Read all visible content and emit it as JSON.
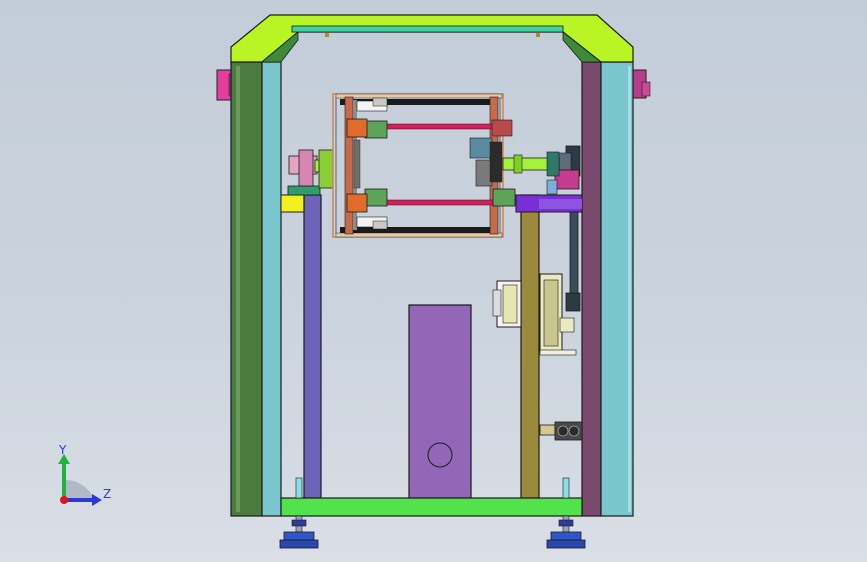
{
  "viewport": {
    "view_name": "Front view",
    "background_top": "#c3cdd9",
    "background_bottom": "#dadfe6"
  },
  "triad": {
    "y_label": "Y",
    "z_label": "Z",
    "x_axis_color": "#e0141e",
    "y_axis_color": "#1fb53a",
    "z_axis_color": "#2a3bd1"
  },
  "colors": {
    "top_frame": "#b9f524",
    "left_post": "#4b7b3e",
    "left_panel": "#79c6cf",
    "right_post": "#7a4a6e",
    "right_panel": "#79c6cf",
    "inner_post_left": "#6d64b8",
    "inner_post_right": "#9b8a3c",
    "cabinet": "#9466b8",
    "base_plate": "#52e34b",
    "feet": "#2f55c8",
    "rods": "#d2205a",
    "motor_shaft": "#a4f23d",
    "handle": "#e43fa0"
  }
}
